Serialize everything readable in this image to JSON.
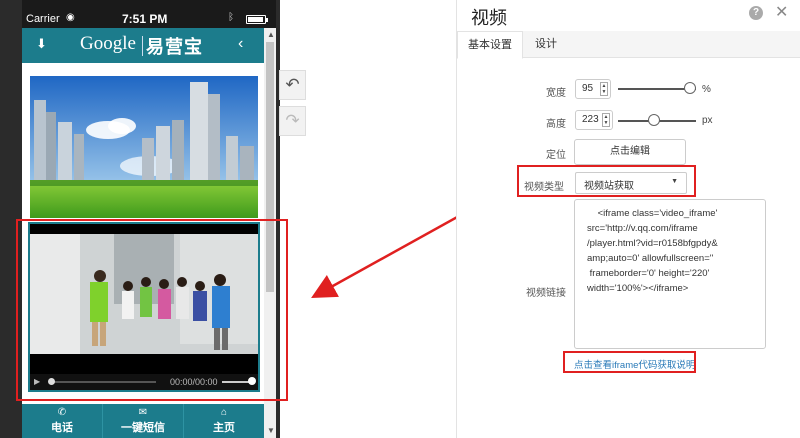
{
  "statusbar": {
    "carrier": "Carrier",
    "time": "7:51 PM"
  },
  "app": {
    "logo_en": "Google",
    "logo_cn": "易营宝",
    "left_icon": "download-arrow-icon",
    "back_icon": "chevron-left-icon"
  },
  "bottom_nav": [
    {
      "label": "电话",
      "icon": "phone-icon"
    },
    {
      "label": "一键短信",
      "icon": "message-icon"
    },
    {
      "label": "主页",
      "icon": "home-icon"
    }
  ],
  "video": {
    "time": "00:00/00:00"
  },
  "toolbar": {
    "undo_icon": "undo-icon",
    "redo_icon": "redo-icon"
  },
  "panel": {
    "title": "视频",
    "tabs": [
      "基本设置",
      "设计"
    ],
    "active_tab": 0,
    "width": {
      "label": "宽度",
      "value": "95",
      "unit": "%",
      "level": 0.95
    },
    "height": {
      "label": "高度",
      "value": "223",
      "unit": "px"
    },
    "position": {
      "label": "定位",
      "button": "点击编辑"
    },
    "video_type": {
      "label": "视频类型",
      "selected": "视频站获取"
    },
    "video_link": {
      "label": "视频链接",
      "value": "    <iframe class='video_iframe'\nsrc='http://v.qq.com/iframe\n/player.html?vid=r0158bfgpdy&\namp;auto=0' allowfullscreen=''\n frameborder='0' height='220'\nwidth='100%'></iframe>"
    },
    "help_link": "点击查看iframe代码获取说明"
  },
  "colors": {
    "theme": "#1c7c8c",
    "highlight": "#e02020",
    "link": "#2a7ab8"
  }
}
